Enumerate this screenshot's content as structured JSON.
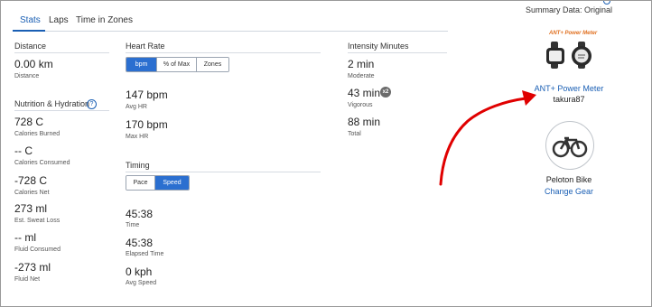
{
  "tabs": [
    {
      "label": "Stats"
    },
    {
      "label": "Laps"
    },
    {
      "label": "Time in Zones"
    }
  ],
  "stats": {
    "distance_title": "Distance",
    "distance_value": "0.00 km",
    "distance_label": "Distance",
    "nutrition_title": "Nutrition & Hydration",
    "items": [
      {
        "value": "728 C",
        "label": "Calories Burned"
      },
      {
        "value": "-- C",
        "label": "Calories Consumed"
      },
      {
        "value": "-728 C",
        "label": "Calories Net"
      },
      {
        "value": "273 ml",
        "label": "Est. Sweat Loss"
      },
      {
        "value": "-- ml",
        "label": "Fluid Consumed"
      },
      {
        "value": "-273 ml",
        "label": "Fluid Net"
      }
    ]
  },
  "heart_rate": {
    "title": "Heart Rate",
    "toggles": [
      "bpm",
      "% of Max",
      "Zones"
    ],
    "avg_value": "147 bpm",
    "avg_label": "Avg HR",
    "max_value": "170 bpm",
    "max_label": "Max HR"
  },
  "timing": {
    "title": "Timing",
    "toggles": [
      "Pace",
      "Speed"
    ],
    "time_value": "45:38",
    "time_label": "Time",
    "elapsed_value": "45:38",
    "elapsed_label": "Elapsed Time",
    "speed_value": "0 kph",
    "speed_label": "Avg Speed"
  },
  "intensity": {
    "title": "Intensity Minutes",
    "moderate_value": "2 min",
    "moderate_label": "Moderate",
    "vigorous_value": "43 min",
    "vigorous_badge": "x2",
    "vigorous_label": "Vigorous",
    "total_value": "88 min",
    "total_label": "Total"
  },
  "sidebar": {
    "summary_label": "Summary Data: Original",
    "device_logo_text": "ANT+ Power Meter",
    "device_name": "ANT+ Power Meter",
    "device_user": "takura87",
    "gear_name": "Peloton Bike",
    "gear_link": "Change Gear"
  },
  "colors": {
    "accent": "#2b6fd0",
    "link": "#1a5fb4",
    "annotation_arrow": "#e00000"
  }
}
